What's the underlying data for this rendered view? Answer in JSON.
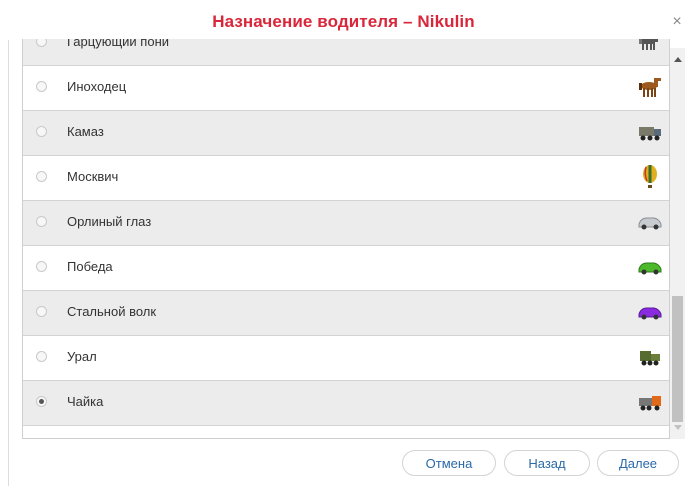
{
  "dialog": {
    "title": "Назначение водителя – Nikulin",
    "close_symbol": "×"
  },
  "rows": [
    {
      "label": "Гарцующий пони",
      "icon": "pony-icon",
      "selected": false
    },
    {
      "label": "Иноходец",
      "icon": "horse-icon",
      "selected": false
    },
    {
      "label": "Камаз",
      "icon": "kamaz-truck-icon",
      "selected": false
    },
    {
      "label": "Москвич",
      "icon": "hot-air-balloon-icon",
      "selected": false
    },
    {
      "label": "Орлиный глаз",
      "icon": "silver-car-icon",
      "selected": false
    },
    {
      "label": "Победа",
      "icon": "green-car-icon",
      "selected": false
    },
    {
      "label": "Стальной волк",
      "icon": "purple-car-icon",
      "selected": false
    },
    {
      "label": "Урал",
      "icon": "military-truck-icon",
      "selected": false
    },
    {
      "label": "Чайка",
      "icon": "orange-truck-icon",
      "selected": true
    }
  ],
  "buttons": {
    "cancel": "Отмена",
    "back": "Назад",
    "next": "Далее"
  },
  "colors": {
    "title": "#d9263a",
    "button_text": "#2b6aa8",
    "row_alt": "#ececec"
  }
}
